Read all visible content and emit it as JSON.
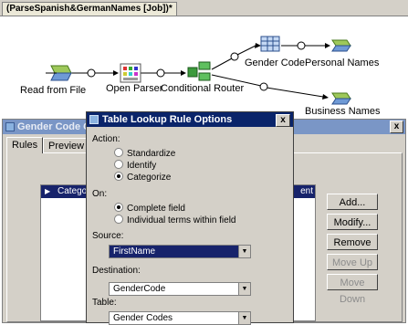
{
  "job_tab": {
    "title": "(ParseSpanish&GermanNames [Job])*"
  },
  "flow": {
    "read_from_file": "Read from File",
    "open_parser": "Open Parser",
    "conditional_router": "Conditional Router",
    "gender_code": "Gender Code",
    "personal_names": "Personal Names",
    "business_names": "Business Names"
  },
  "gender_window": {
    "title": "Gender Code O",
    "close_label": "x",
    "tabs": [
      "Rules",
      "Preview"
    ],
    "rule_row": {
      "category": "Categorize",
      "extra": "ent"
    },
    "buttons": {
      "add": "Add...",
      "modify": "Modify...",
      "remove": "Remove",
      "move_up": "Move Up",
      "move_down": "Move Down"
    }
  },
  "dialog": {
    "title": "Table Lookup Rule Options",
    "close_label": "x",
    "action_label": "Action:",
    "actions": [
      {
        "label": "Standardize",
        "selected": false
      },
      {
        "label": "Identify",
        "selected": false
      },
      {
        "label": "Categorize",
        "selected": true
      }
    ],
    "on_label": "On:",
    "on_options": [
      {
        "label": "Complete field",
        "selected": true
      },
      {
        "label": "Individual terms within field",
        "selected": false
      }
    ],
    "source_label": "Source:",
    "source_value": "FirstName",
    "destination_label": "Destination:",
    "destination_value": "GenderCode",
    "table_label": "Table:",
    "table_value": "Gender Codes"
  },
  "colors": {
    "titlebar_active": "#0a246a",
    "titlebar_inactive": "#7a96c6",
    "selection": "#17236b",
    "dialog_face": "#d4d0c8"
  }
}
